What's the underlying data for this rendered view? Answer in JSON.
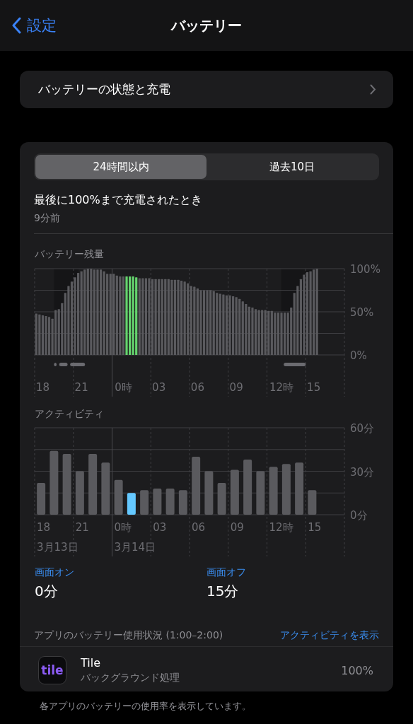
{
  "nav": {
    "back": "設定",
    "title": "バッテリー"
  },
  "health_row": {
    "label": "バッテリーの状態と充電"
  },
  "segments": [
    {
      "label": "24時間以内",
      "selected": true
    },
    {
      "label": "過去10日",
      "selected": false
    }
  ],
  "last_charge": {
    "label": "最後に100%まで充電されたとき",
    "value": "9分前"
  },
  "battery_level": {
    "title": "バッテリー残量",
    "chart_data": {
      "type": "bar",
      "stacked": true,
      "ylim": [
        0,
        100
      ],
      "yticks": [
        {
          "value": 0,
          "label": "0%"
        },
        {
          "value": 50,
          "label": "50%"
        },
        {
          "value": 100,
          "label": "100%"
        }
      ],
      "categories": [
        null,
        null,
        "18",
        null,
        null,
        null,
        null,
        null,
        null,
        null,
        null,
        null,
        null,
        null,
        "21",
        null,
        null,
        null,
        null,
        null,
        null,
        null,
        null,
        null,
        null,
        null,
        null,
        "0時",
        null,
        null,
        null,
        null,
        null,
        null,
        null,
        null,
        null,
        null,
        "03",
        null,
        null,
        null,
        null,
        null,
        null,
        null,
        null,
        null,
        null,
        null,
        "06",
        null,
        null,
        null,
        null,
        null,
        null,
        null,
        null,
        null,
        null,
        null,
        "09",
        null,
        null,
        null,
        null,
        null,
        null,
        null,
        null,
        null,
        null,
        null,
        null,
        null,
        "12時",
        null,
        null,
        null,
        null,
        null,
        null,
        null,
        null,
        null,
        "15",
        null,
        null,
        null,
        null,
        null,
        null,
        null,
        null,
        null
      ],
      "series": [
        {
          "color": "#5a5a5e",
          "values": [
            48,
            47,
            46,
            45,
            44,
            42,
            52,
            53,
            60,
            72,
            80,
            85,
            90,
            95,
            97,
            99,
            100,
            100,
            99,
            99,
            99,
            97,
            94,
            94,
            94,
            92,
            91,
            91,
            null,
            null,
            null,
            null,
            89,
            89,
            89,
            89,
            88,
            88,
            88,
            88,
            88,
            88,
            87,
            87,
            87,
            86,
            85,
            83,
            80,
            79,
            77,
            75,
            75,
            75,
            75,
            74,
            72,
            71,
            70,
            69,
            69,
            68,
            67,
            65,
            62,
            59,
            56,
            55,
            53,
            52,
            52,
            52,
            51,
            51,
            49,
            49,
            49,
            49,
            49,
            55,
            72,
            80,
            88,
            93,
            96,
            97,
            99,
            100,
            null,
            null,
            null,
            null,
            null,
            null,
            null,
            null
          ]
        },
        {
          "color": "#65d46e",
          "values": [
            null,
            null,
            null,
            null,
            null,
            null,
            null,
            null,
            null,
            null,
            null,
            null,
            null,
            null,
            null,
            null,
            null,
            null,
            null,
            null,
            null,
            null,
            null,
            null,
            null,
            null,
            null,
            null,
            91,
            91,
            91,
            90,
            null,
            null,
            null,
            null,
            null,
            null,
            null,
            null,
            null,
            null,
            null,
            null,
            null,
            null,
            null,
            null,
            null,
            null,
            null,
            null,
            null,
            null,
            null,
            null,
            null,
            null,
            null,
            null,
            null,
            null,
            null,
            null,
            null,
            null,
            null,
            null,
            null,
            null,
            null,
            null,
            null,
            null,
            null,
            null,
            null,
            null,
            null,
            null,
            null,
            null,
            null,
            null,
            null,
            null,
            null,
            null,
            null,
            null,
            null,
            null,
            null,
            null,
            null,
            null
          ]
        }
      ]
    }
  },
  "activity": {
    "title": "アクティビティ",
    "dates": [
      "3月13日",
      "3月14日"
    ],
    "chart_data": {
      "type": "bar",
      "stacked": true,
      "ylim": [
        0,
        60
      ],
      "yticks": [
        {
          "value": 0,
          "label": "0分"
        },
        {
          "value": 30,
          "label": "30分"
        },
        {
          "value": 60,
          "label": "60分"
        }
      ],
      "categories": [
        "18",
        null,
        null,
        "21",
        null,
        null,
        "0時",
        null,
        null,
        "03",
        null,
        null,
        "06",
        null,
        null,
        "09",
        null,
        null,
        "12時",
        null,
        null,
        "15",
        null,
        null
      ],
      "series": [
        {
          "color": "#5a5a5e",
          "values": [
            22,
            44,
            42,
            30,
            42,
            36,
            24,
            null,
            17,
            18,
            18,
            17,
            40,
            30,
            22,
            31,
            38,
            30,
            33,
            35,
            36,
            17,
            null,
            null
          ]
        },
        {
          "color": "#64c8ff",
          "values": [
            null,
            null,
            null,
            null,
            null,
            null,
            null,
            15,
            null,
            null,
            null,
            null,
            null,
            null,
            null,
            null,
            null,
            null,
            null,
            null,
            null,
            null,
            null,
            null
          ]
        }
      ]
    }
  },
  "screen": [
    {
      "label": "画面オン",
      "value": "0分"
    },
    {
      "label": "画面オフ",
      "value": "15分"
    }
  ],
  "app_usage": {
    "header": "アプリのバッテリー使用状況 (1:00–2:00)",
    "link": "アクティビティを表示",
    "apps": [
      {
        "icon_text": "tile",
        "name": "Tile",
        "detail": "バックグラウンド処理",
        "percent": "100%"
      }
    ]
  },
  "footer": "各アプリのバッテリーの使用率を表示しています。"
}
